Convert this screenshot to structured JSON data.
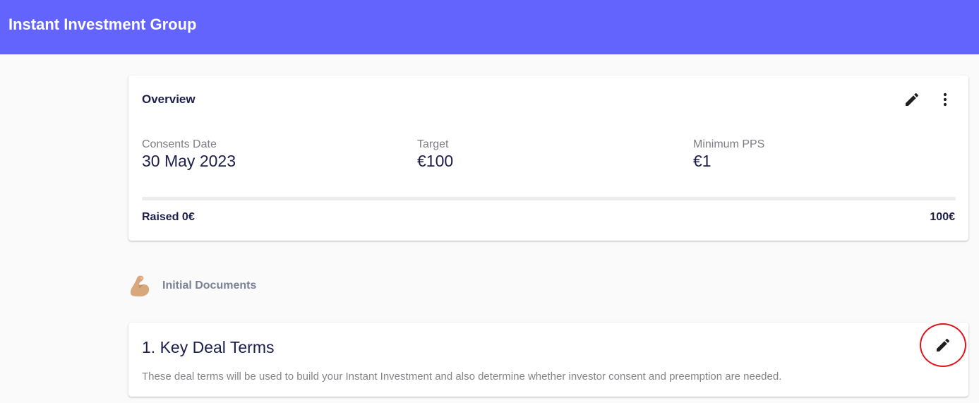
{
  "app": {
    "title": "Instant Investment Group"
  },
  "overview": {
    "title": "Overview",
    "stats": [
      {
        "label": "Consents Date",
        "value": "30 May 2023"
      },
      {
        "label": "Target",
        "value": "€100"
      },
      {
        "label": "Minimum PPS",
        "value": "€1"
      }
    ],
    "progress": {
      "fraction": 0,
      "raised_label": "Raised 0€",
      "target_label": "100€"
    }
  },
  "section": {
    "label": "Initial Documents",
    "icon": "flexed-biceps-icon"
  },
  "deal_terms": {
    "title": "1. Key Deal Terms",
    "description": "These deal terms will be used to build your Instant Investment and also determine whether investor consent and preemption are needed."
  },
  "colors": {
    "appbar": "#6264fd",
    "heading": "#1c1f4a",
    "highlight_circle": "#e0141d"
  }
}
